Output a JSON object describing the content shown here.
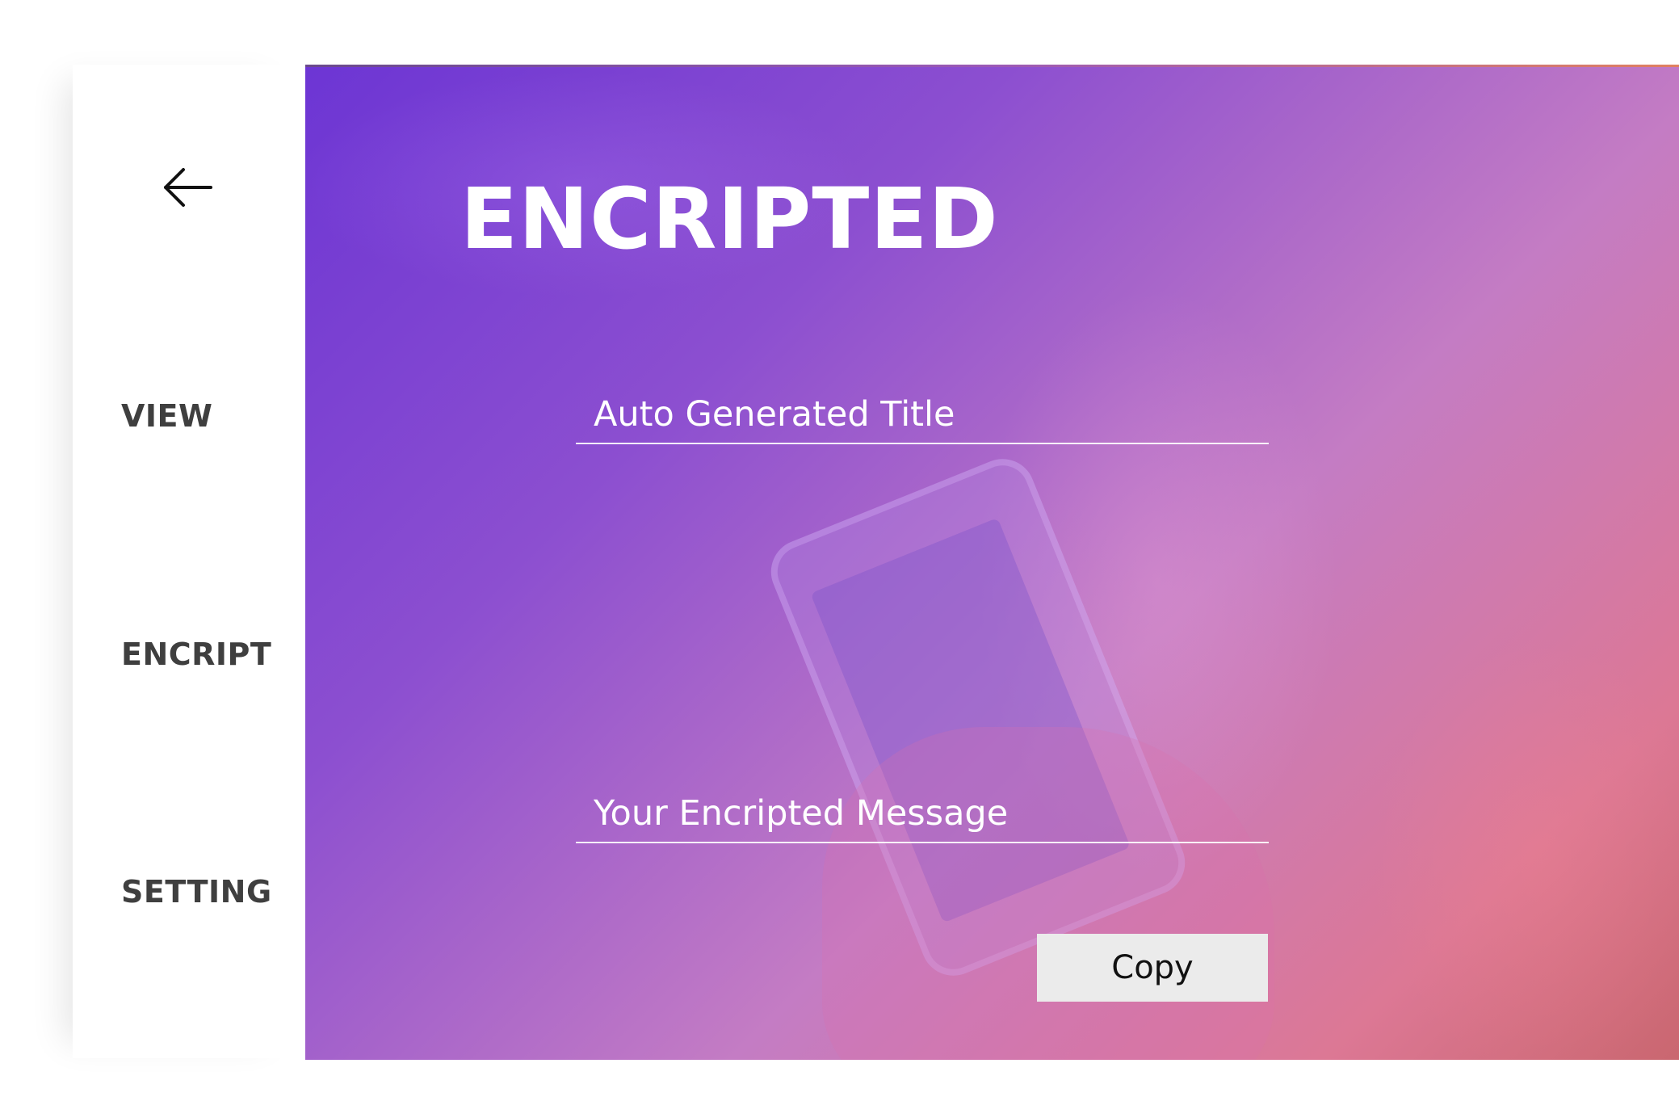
{
  "sidebar": {
    "back_icon": "arrow-left-icon",
    "items": [
      {
        "label": "VIEW"
      },
      {
        "label": "ENCRIPT"
      },
      {
        "label": "SETTING"
      }
    ]
  },
  "main": {
    "title": "ENCRIPTED",
    "title_field": {
      "value": "Auto Generated Title"
    },
    "message_field": {
      "value": "Your Encripted Message"
    },
    "copy_label": "Copy"
  },
  "colors": {
    "gradient_start": "#6024d0",
    "gradient_end": "#c45660",
    "nav_text": "#3f3f3f",
    "button_bg": "#ebebeb"
  }
}
